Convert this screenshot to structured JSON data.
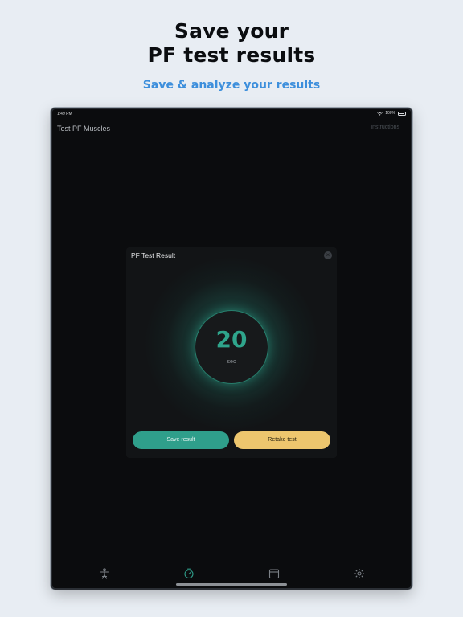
{
  "promo": {
    "headline_line1": "Save your",
    "headline_line2": "PF test results",
    "subheadline": "Save & analyze your results"
  },
  "status_bar": {
    "time": "1:49 PM",
    "battery": "100%"
  },
  "nav": {
    "title": "Test PF Muscles",
    "action": "Instructions"
  },
  "modal": {
    "title": "PF Test Result",
    "close_glyph": "×",
    "timer_value": "20",
    "timer_unit": "sec",
    "save_label": "Save result",
    "retake_label": "Retake test"
  },
  "tabs": [
    {
      "icon": "exercise-figure-icon"
    },
    {
      "icon": "timer-icon",
      "active": true
    },
    {
      "icon": "calendar-icon"
    },
    {
      "icon": "gear-icon"
    }
  ],
  "colors": {
    "accent_teal": "#2f9f8b",
    "accent_yellow": "#edc66e",
    "subheadline_blue": "#3d8fdc",
    "background": "#e8edf3"
  }
}
